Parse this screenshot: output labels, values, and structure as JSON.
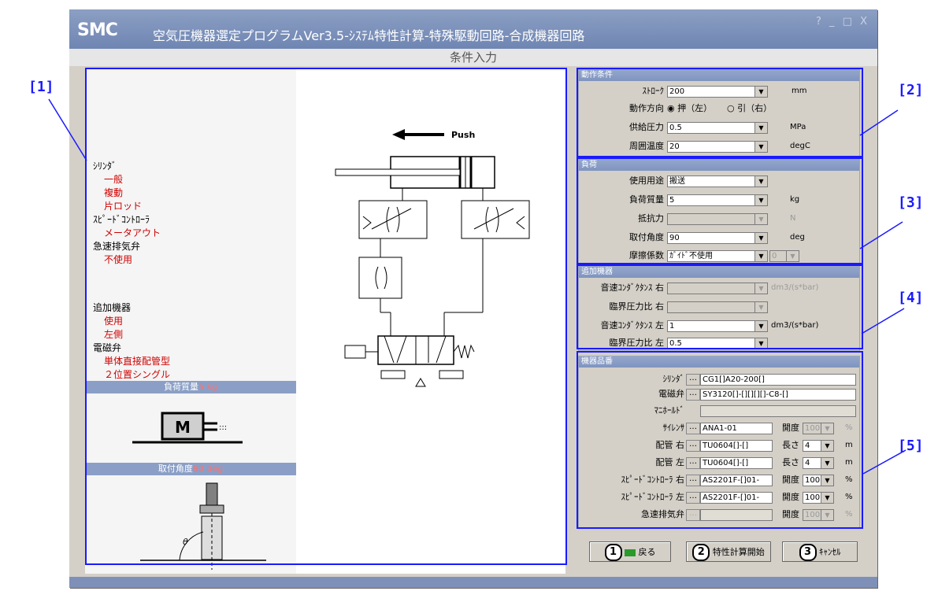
{
  "window": {
    "logo": "SMC",
    "title": "空気圧機器選定プログラムVer3.5-ｼｽﾃﾑ特性計算-特殊駆動回路-合成機器回路",
    "controls": "? _ □ X",
    "subtitle": "条件入力"
  },
  "spec": {
    "cylinder_label": "ｼﾘﾝﾀﾞ",
    "cylinder_values": [
      "一般",
      "複動",
      "片ロッド"
    ],
    "speed_ctrl_label": "ｽﾋﾟｰﾄﾞｺﾝﾄﾛｰﾗ",
    "speed_ctrl_value": "メータアウト",
    "quick_exhaust_label": "急速排気弁",
    "quick_exhaust_value": "不使用",
    "extra_label": "追加機器",
    "extra_values": [
      "使用",
      "左側"
    ],
    "solenoid_label": "電磁弁",
    "solenoid_values": [
      "単体直接配管型",
      "２位置シングル"
    ],
    "load_mass_bar": "負荷質量",
    "load_mass_value": "5 kg",
    "mount_angle_bar": "取付角度",
    "mount_angle_value": "90 deg",
    "mass_icon_label": "M",
    "theta": "θ"
  },
  "diagram": {
    "push_label": "Push"
  },
  "operation": {
    "header": "動作条件",
    "stroke_label": "ｽﾄﾛｰｸ",
    "stroke_value": "200",
    "stroke_unit": "mm",
    "direction_label": "動作方向",
    "dir_push": "押（左）",
    "dir_pull": "引（右）",
    "pressure_label": "供給圧力",
    "pressure_value": "0.5",
    "pressure_unit": "MPa",
    "temp_label": "周囲温度",
    "temp_value": "20",
    "temp_unit": "degC"
  },
  "load": {
    "header": "負荷",
    "use_label": "使用用途",
    "use_value": "搬送",
    "mass_label": "負荷質量",
    "mass_value": "5",
    "mass_unit": "kg",
    "resist_label": "抵抗力",
    "resist_value": "",
    "resist_unit": "N",
    "angle_label": "取付角度",
    "angle_value": "90",
    "angle_unit": "deg",
    "friction_label": "摩擦係数",
    "friction_value": "ｶﾞｲﾄﾞ不使用",
    "friction_value2": "0"
  },
  "extra": {
    "header": "追加機器",
    "sonic_r_label": "音速ｺﾝﾀﾞｸﾀﾝｽ 右",
    "sonic_r_value": "",
    "sonic_r_unit": "dm3/(s*bar)",
    "crit_r_label": "臨界圧力比 右",
    "crit_r_value": "",
    "sonic_l_label": "音速ｺﾝﾀﾞｸﾀﾝｽ 左",
    "sonic_l_value": "1",
    "sonic_l_unit": "dm3/(s*bar)",
    "crit_l_label": "臨界圧力比 左",
    "crit_l_value": "0.5"
  },
  "parts": {
    "header": "機器品番",
    "dots": "…",
    "cylinder_label": "ｼﾘﾝﾀﾞ",
    "cylinder_value": "CG1[]A20-200[]",
    "solenoid_label": "電磁弁",
    "solenoid_value": "SY3120[]-[][][][]-C8-[]",
    "manifold_label": "ﾏﾆﾎｰﾙﾄﾞ",
    "manifold_value": "",
    "silencer_label": "ｻｲﾚﾝｻ",
    "silencer_value": "ANA1-01",
    "silencer_open_label": "開度",
    "silencer_open": "100",
    "pct": "%",
    "pipe_r_label": "配管 右",
    "pipe_r_value": "TU0604[]-[]",
    "len_label": "長さ",
    "pipe_r_len": "4",
    "len_unit": "m",
    "pipe_l_label": "配管 左",
    "pipe_l_value": "TU0604[]-[]",
    "pipe_l_len": "4",
    "sc_r_label": "ｽﾋﾟｰﾄﾞｺﾝﾄﾛｰﾗ 右",
    "sc_r_value": "AS2201F-[]01-",
    "sc_r_open": "100",
    "sc_l_label": "ｽﾋﾟｰﾄﾞｺﾝﾄﾛｰﾗ 左",
    "sc_l_value": "AS2201F-[]01-",
    "sc_l_open": "100",
    "qe_label": "急速排気弁",
    "qe_value": "",
    "qe_open": "100"
  },
  "buttons": {
    "back": "戻る",
    "back_num": "1",
    "calc": "特性計算開始",
    "calc_num": "2",
    "cancel": "ｷｬﾝｾﾙ",
    "cancel_num": "3"
  },
  "annotations": [
    "[1]",
    "[2]",
    "[3]",
    "[4]",
    "[5]"
  ],
  "colors": {
    "annotation": "#1a1aff",
    "accent_red": "#d00000",
    "title_bar": "#6f86b3"
  }
}
